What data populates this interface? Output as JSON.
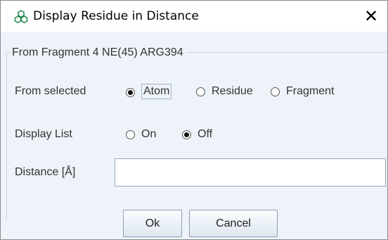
{
  "window": {
    "title": "Display Residue in Distance",
    "close_glyph": "✕"
  },
  "group": {
    "title": "From Fragment 4 NE(45) ARG394"
  },
  "from_selected": {
    "label": "From selected",
    "options": [
      {
        "label": "Atom",
        "selected": true
      },
      {
        "label": "Residue",
        "selected": false
      },
      {
        "label": "Fragment",
        "selected": false
      }
    ]
  },
  "display_list": {
    "label": "Display List",
    "options": [
      {
        "label": "On",
        "selected": false
      },
      {
        "label": "Off",
        "selected": true
      }
    ]
  },
  "distance": {
    "label": "Distance [Å]",
    "value": ""
  },
  "buttons": {
    "ok": "Ok",
    "cancel": "Cancel"
  },
  "colors": {
    "background": "#eef3f9",
    "icon": "#2e8b57"
  }
}
